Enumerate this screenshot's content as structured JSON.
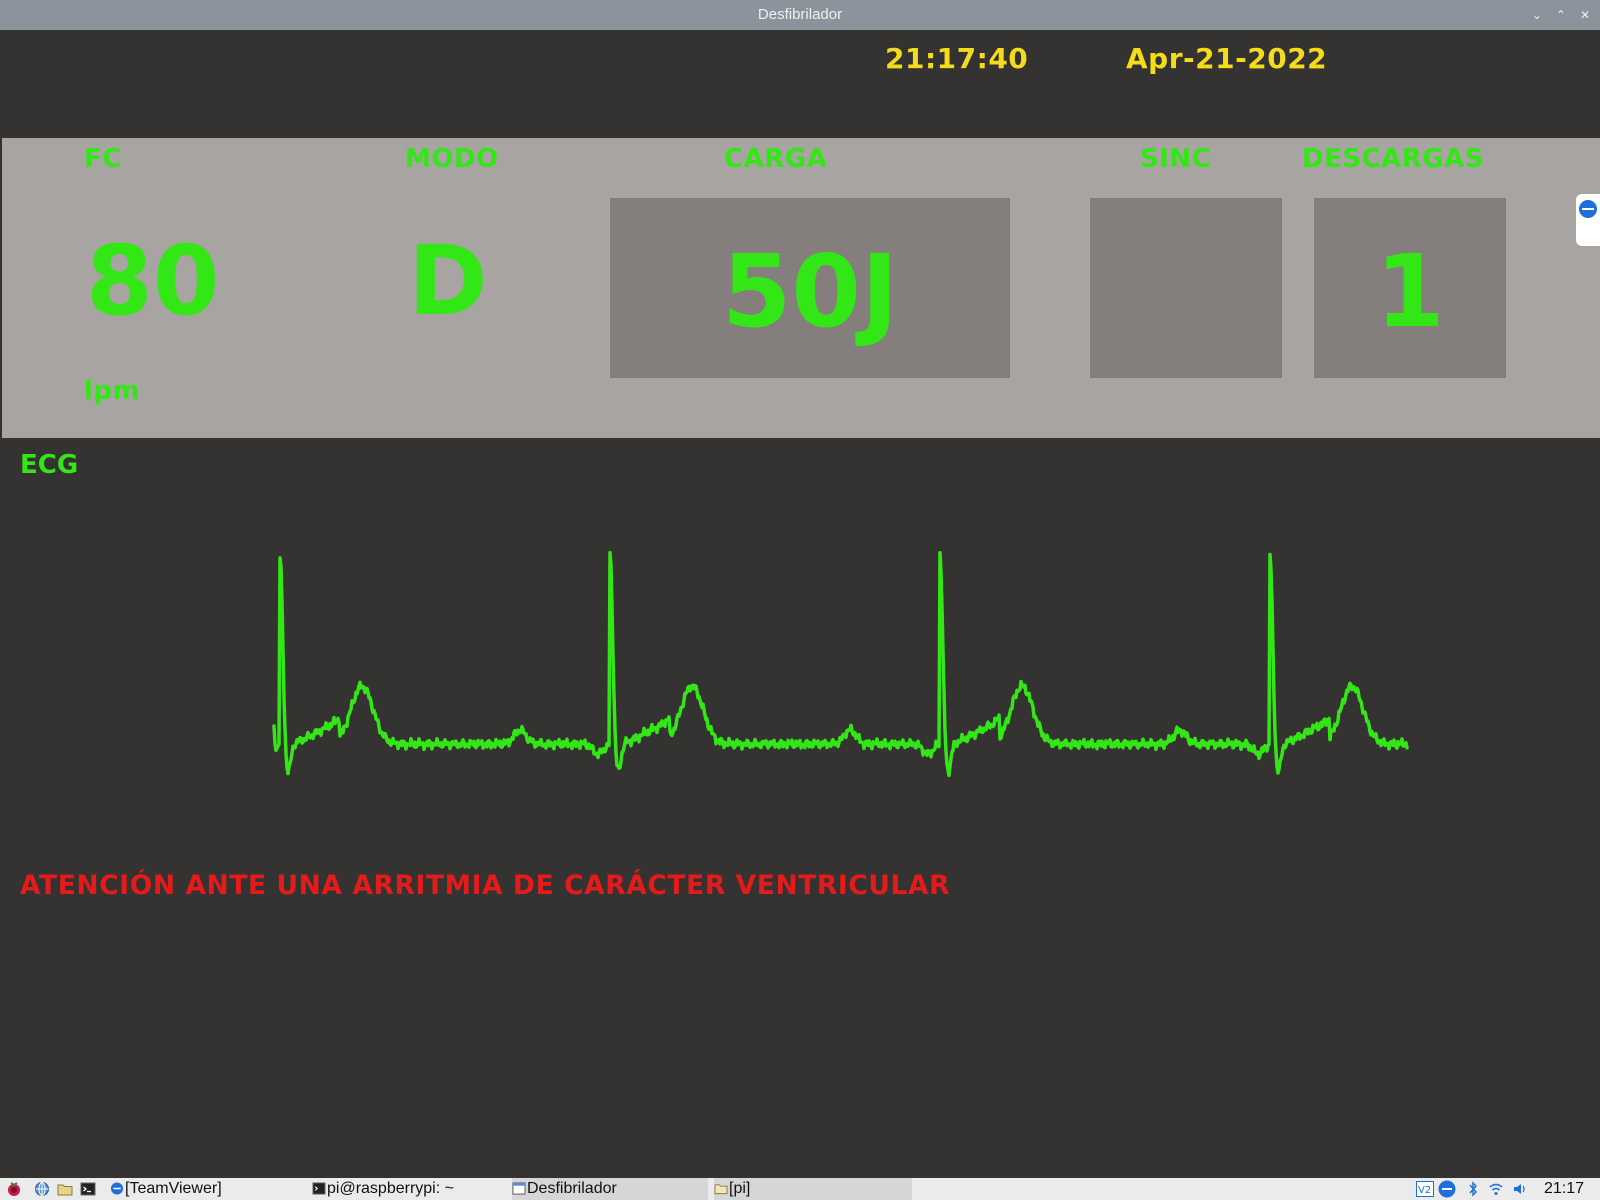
{
  "window": {
    "title": "Desfibrilador",
    "buttons": [
      "⌄",
      "⌃",
      "✕"
    ]
  },
  "header": {
    "time": "21:17:40",
    "date": "Apr-21-2022"
  },
  "panel": {
    "fc": {
      "label": "FC",
      "value": "80",
      "unit": "lpm"
    },
    "modo": {
      "label": "MODO",
      "value": "D"
    },
    "carga": {
      "label": "CARGA",
      "value": "50J"
    },
    "sinc": {
      "label": "SINC",
      "value": ""
    },
    "descargas": {
      "label": "DESCARGAS",
      "value": "1"
    }
  },
  "ecg": {
    "label": "ECG",
    "color": "#33e616"
  },
  "alert": {
    "text": "ATENCIÓN ANTE UNA ARRITMIA DE CARÁCTER VENTRICULAR",
    "color": "#e31b1b"
  },
  "taskbar": {
    "items": [
      {
        "label": "[TeamViewer]",
        "icon": "teamviewer-icon"
      },
      {
        "label": "pi@raspberrypi: ~",
        "icon": "terminal-icon"
      },
      {
        "label": "Desfibrilador",
        "icon": "window-icon"
      },
      {
        "label": "[pi]",
        "icon": "folder-icon"
      }
    ],
    "clock": "21:17"
  }
}
